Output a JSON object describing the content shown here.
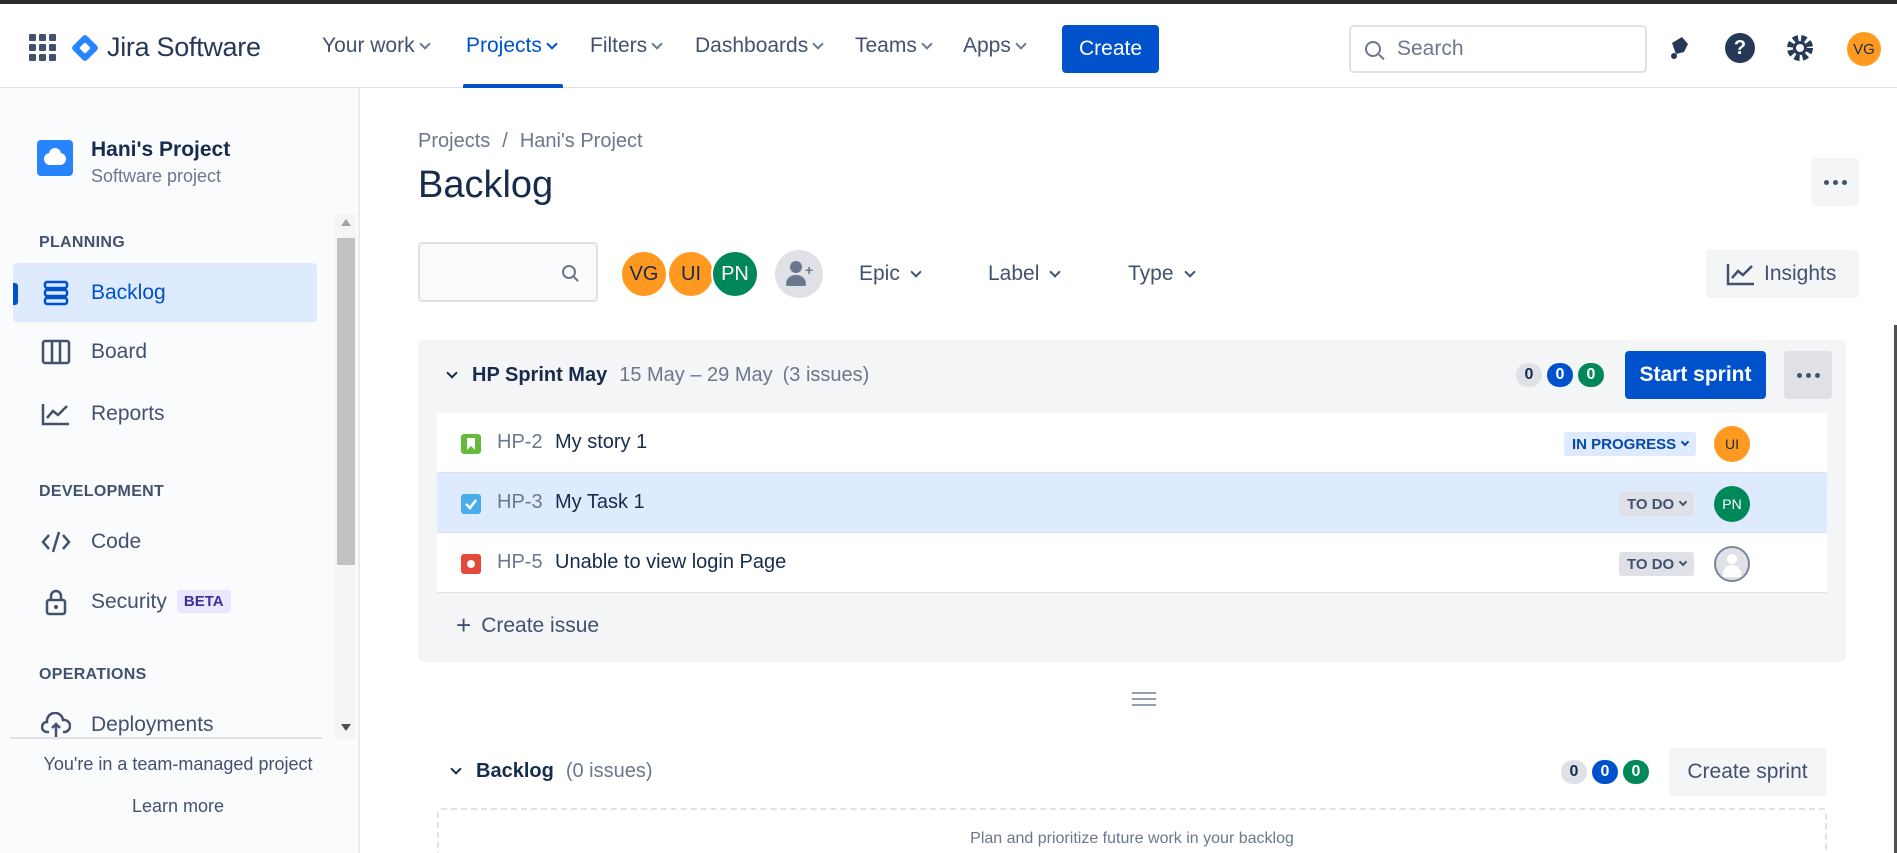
{
  "topnav": {
    "logo_text": "Jira Software",
    "items": [
      {
        "label": "Your work"
      },
      {
        "label": "Projects"
      },
      {
        "label": "Filters"
      },
      {
        "label": "Dashboards"
      },
      {
        "label": "Teams"
      },
      {
        "label": "Apps"
      }
    ],
    "create_label": "Create",
    "search_placeholder": "Search",
    "user_initials": "VG"
  },
  "sidebar": {
    "project_name": "Hani's Project",
    "project_type": "Software project",
    "sections": {
      "planning": "PLANNING",
      "development": "DEVELOPMENT",
      "operations": "OPERATIONS"
    },
    "items": {
      "backlog": "Backlog",
      "board": "Board",
      "reports": "Reports",
      "code": "Code",
      "security": "Security",
      "security_badge": "BETA",
      "deployments": "Deployments"
    },
    "team_note": "You're in a team-managed project",
    "learn_more": "Learn more"
  },
  "main": {
    "breadcrumb": {
      "root": "Projects",
      "sep": "/",
      "project": "Hani's Project"
    },
    "title": "Backlog",
    "filters": {
      "avatars": [
        {
          "initials": "VG",
          "color": "#FF991F"
        },
        {
          "initials": "UI",
          "color": "#FF991F"
        },
        {
          "initials": "PN",
          "color": "#00875A"
        }
      ],
      "epic": "Epic",
      "label": "Label",
      "type": "Type",
      "insights": "Insights"
    },
    "sprint": {
      "name": "HP Sprint May",
      "dates": "15 May – 29 May",
      "issue_count": "(3 issues)",
      "counts": {
        "todo": "0",
        "inprogress": "0",
        "done": "0"
      },
      "start_label": "Start sprint",
      "issues": [
        {
          "key": "HP-2",
          "summary": "My story 1",
          "type": "story",
          "status": "IN PROGRESS",
          "assignee": "UI"
        },
        {
          "key": "HP-3",
          "summary": "My Task 1",
          "type": "task",
          "status": "TO DO",
          "assignee": "PN"
        },
        {
          "key": "HP-5",
          "summary": "Unable to view login Page",
          "type": "bug",
          "status": "TO DO",
          "assignee": ""
        }
      ],
      "create_issue": "Create issue"
    },
    "backlog": {
      "name": "Backlog",
      "issue_count": "(0 issues)",
      "counts": {
        "todo": "0",
        "inprogress": "0",
        "done": "0"
      },
      "create_sprint": "Create sprint",
      "empty_text": "Plan and prioritize future work in your backlog"
    }
  },
  "colors": {
    "brand": "#0052CC",
    "story": "#63BA3C",
    "task": "#4BADE8",
    "bug": "#E5493A"
  }
}
